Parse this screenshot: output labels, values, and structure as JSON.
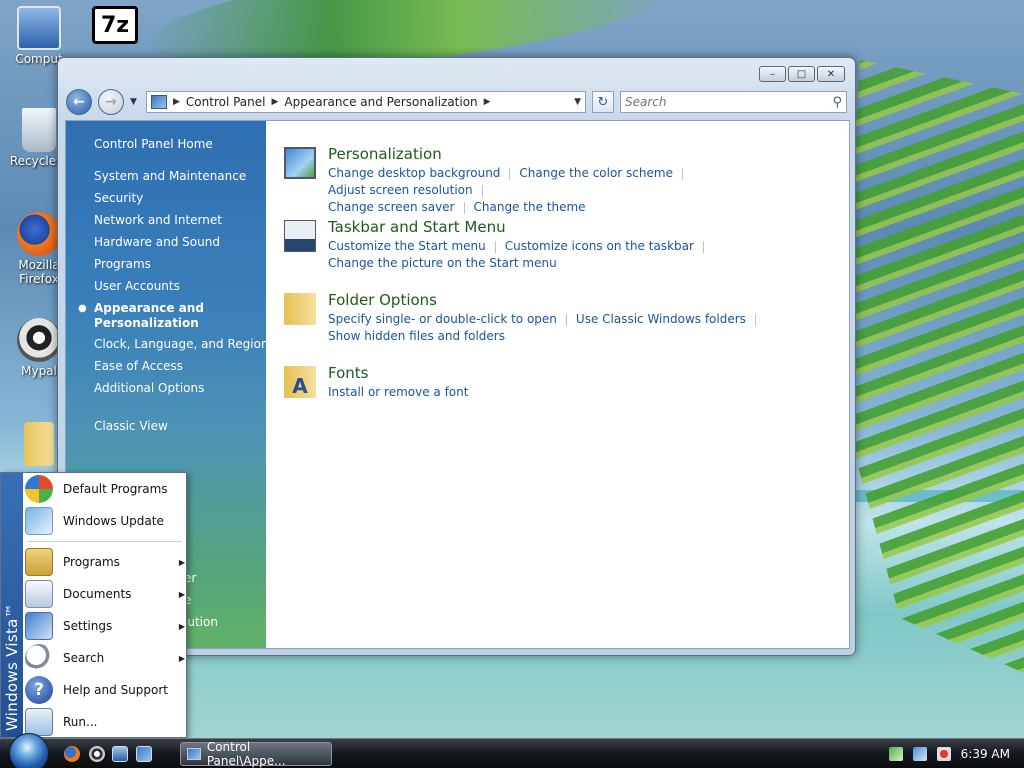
{
  "desktop": {
    "icons": [
      {
        "label": "Comput",
        "icon": "computer-icon"
      },
      {
        "label": "Recycle B",
        "icon": "recycle-bin-icon"
      },
      {
        "label": "Mozilla Firefox",
        "icon": "firefox-icon"
      },
      {
        "label": "Mypal",
        "icon": "mypal-icon"
      },
      {
        "label": "7z",
        "icon": "7zip-icon"
      }
    ]
  },
  "window": {
    "address": {
      "segments": [
        "Control Panel",
        "Appearance and Personalization"
      ]
    },
    "search_placeholder": "Search",
    "controls": {
      "minimize": "–",
      "maximize": "□",
      "close": "✕"
    },
    "sidebar": {
      "home": "Control Panel Home",
      "items": [
        "System and Maintenance",
        "Security",
        "Network and Internet",
        "Hardware and Sound",
        "Programs",
        "User Accounts",
        "Appearance and Personalization",
        "Clock, Language, and Region",
        "Ease of Access",
        "Additional Options"
      ],
      "active_index": 6,
      "classic_view": "Classic View",
      "lower_links": [
        "er",
        "e",
        "lution"
      ]
    },
    "categories": [
      {
        "title": "Personalization",
        "icon": "personalization-icon",
        "links": [
          "Change desktop background",
          "Change the color scheme",
          "Adjust screen resolution",
          "Change screen saver",
          "Change the theme"
        ]
      },
      {
        "title": "Taskbar and Start Menu",
        "icon": "taskbar-icon",
        "links": [
          "Customize the Start menu",
          "Customize icons on the taskbar",
          "Change the picture on the Start menu"
        ]
      },
      {
        "title": "Folder Options",
        "icon": "folder-options-icon",
        "links": [
          "Specify single- or double-click to open",
          "Use Classic Windows folders",
          "Show hidden files and folders"
        ]
      },
      {
        "title": "Fonts",
        "icon": "fonts-icon",
        "links": [
          "Install or remove a font"
        ]
      }
    ]
  },
  "start_menu": {
    "brand": "Windows Vista™",
    "top_items": [
      {
        "label": "Default Programs",
        "icon": "default-programs-icon"
      },
      {
        "label": "Windows Update",
        "icon": "windows-update-icon"
      }
    ],
    "items": [
      {
        "label": "Programs",
        "icon": "programs-icon",
        "has_submenu": true
      },
      {
        "label": "Documents",
        "icon": "documents-icon",
        "has_submenu": true
      },
      {
        "label": "Settings",
        "icon": "settings-icon",
        "has_submenu": true
      },
      {
        "label": "Search",
        "icon": "search-icon",
        "has_submenu": true
      },
      {
        "label": "Help and Support",
        "icon": "help-icon",
        "has_submenu": false
      },
      {
        "label": "Run...",
        "icon": "run-icon",
        "has_submenu": false
      }
    ]
  },
  "taskbar": {
    "task_label": "Control Panel\\Appe...",
    "clock": "6:39 AM"
  }
}
